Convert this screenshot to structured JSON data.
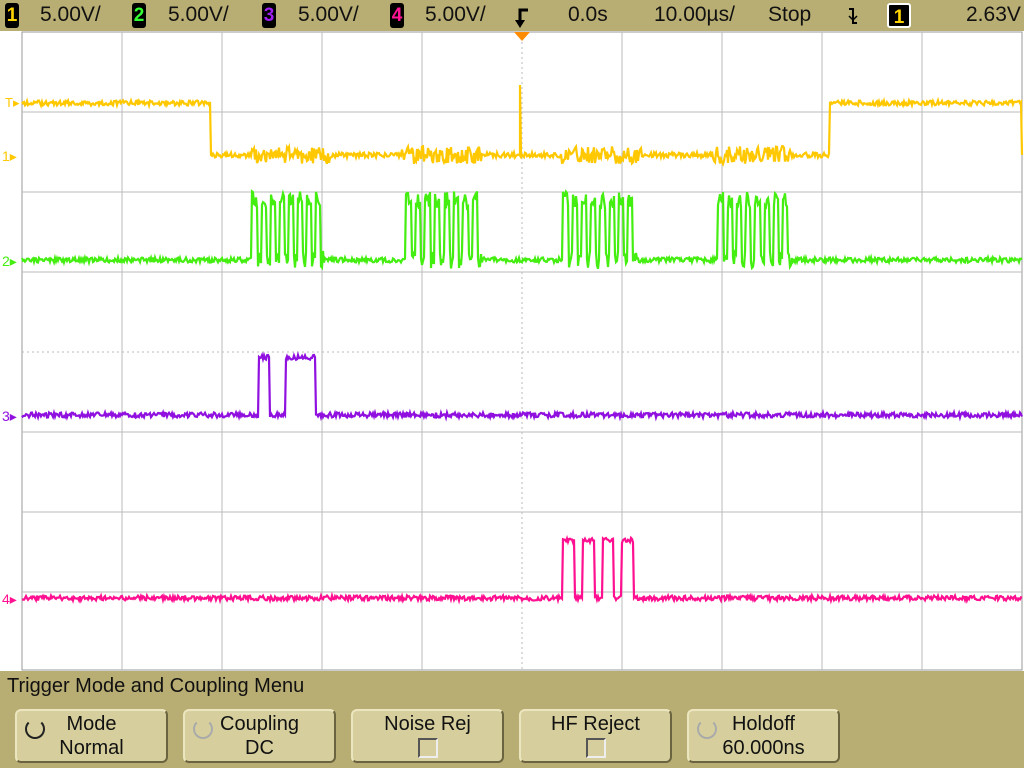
{
  "status_bar": {
    "channels": [
      {
        "num": "1",
        "scale": "5.00V/",
        "color": "#ffd400"
      },
      {
        "num": "2",
        "scale": "5.00V/",
        "color": "#33ff33"
      },
      {
        "num": "3",
        "scale": "5.00V/",
        "color": "#a020f0"
      },
      {
        "num": "4",
        "scale": "5.00V/",
        "color": "#ff1493"
      }
    ],
    "delay": "0.0s",
    "timebase": "10.00µs/",
    "run_state": "Stop",
    "trigger_slope_icon": "falling-edge-icon",
    "trigger_source": "1",
    "trigger_level": "2.63V"
  },
  "display": {
    "time_per_div_us": 10,
    "volts_per_div": 5,
    "grid": true,
    "traces": [
      {
        "channel": "1",
        "color": "#ffc800",
        "baseline_v": 0,
        "high_segments_us": [
          [
            -50,
            -31.2
          ],
          [
            30.8,
            50
          ]
        ],
        "spikes_us": [
          -0.2
        ],
        "noise_bursts_us": [
          [
            -27,
            -19
          ],
          [
            -12,
            -4
          ],
          [
            4,
            12
          ],
          [
            19,
            27
          ]
        ]
      },
      {
        "channel": "2",
        "color": "#44ee11",
        "baseline_v": 0,
        "pulse_bursts_us": [
          [
            -27,
            -19.7
          ],
          [
            -11.6,
            -4
          ],
          [
            4.1,
            11.5
          ],
          [
            19.6,
            27
          ]
        ],
        "pulse_level_v": 3.75
      },
      {
        "channel": "3",
        "color": "#9010e0",
        "baseline_v": 0,
        "high_segments_us": [
          [
            -26.4,
            -25.2
          ],
          [
            -23.6,
            -20.6
          ]
        ],
        "pulse_level_v": 3.6
      },
      {
        "channel": "4",
        "color": "#ff1090",
        "baseline_v": 0,
        "high_segments_us": [
          [
            4.1,
            5.3
          ],
          [
            6.1,
            7.2
          ],
          [
            8.1,
            9.2
          ],
          [
            10,
            11.2
          ]
        ],
        "pulse_level_v": 3.6
      }
    ]
  },
  "menu": {
    "title": "Trigger Mode and Coupling Menu",
    "softkeys": [
      {
        "label": "Mode",
        "value": "Normal"
      },
      {
        "label": "Coupling",
        "value": "DC"
      },
      {
        "label": "Noise Rej",
        "value": ""
      },
      {
        "label": "HF Reject",
        "value": ""
      },
      {
        "label": "Holdoff",
        "value": "60.000ns"
      }
    ]
  }
}
